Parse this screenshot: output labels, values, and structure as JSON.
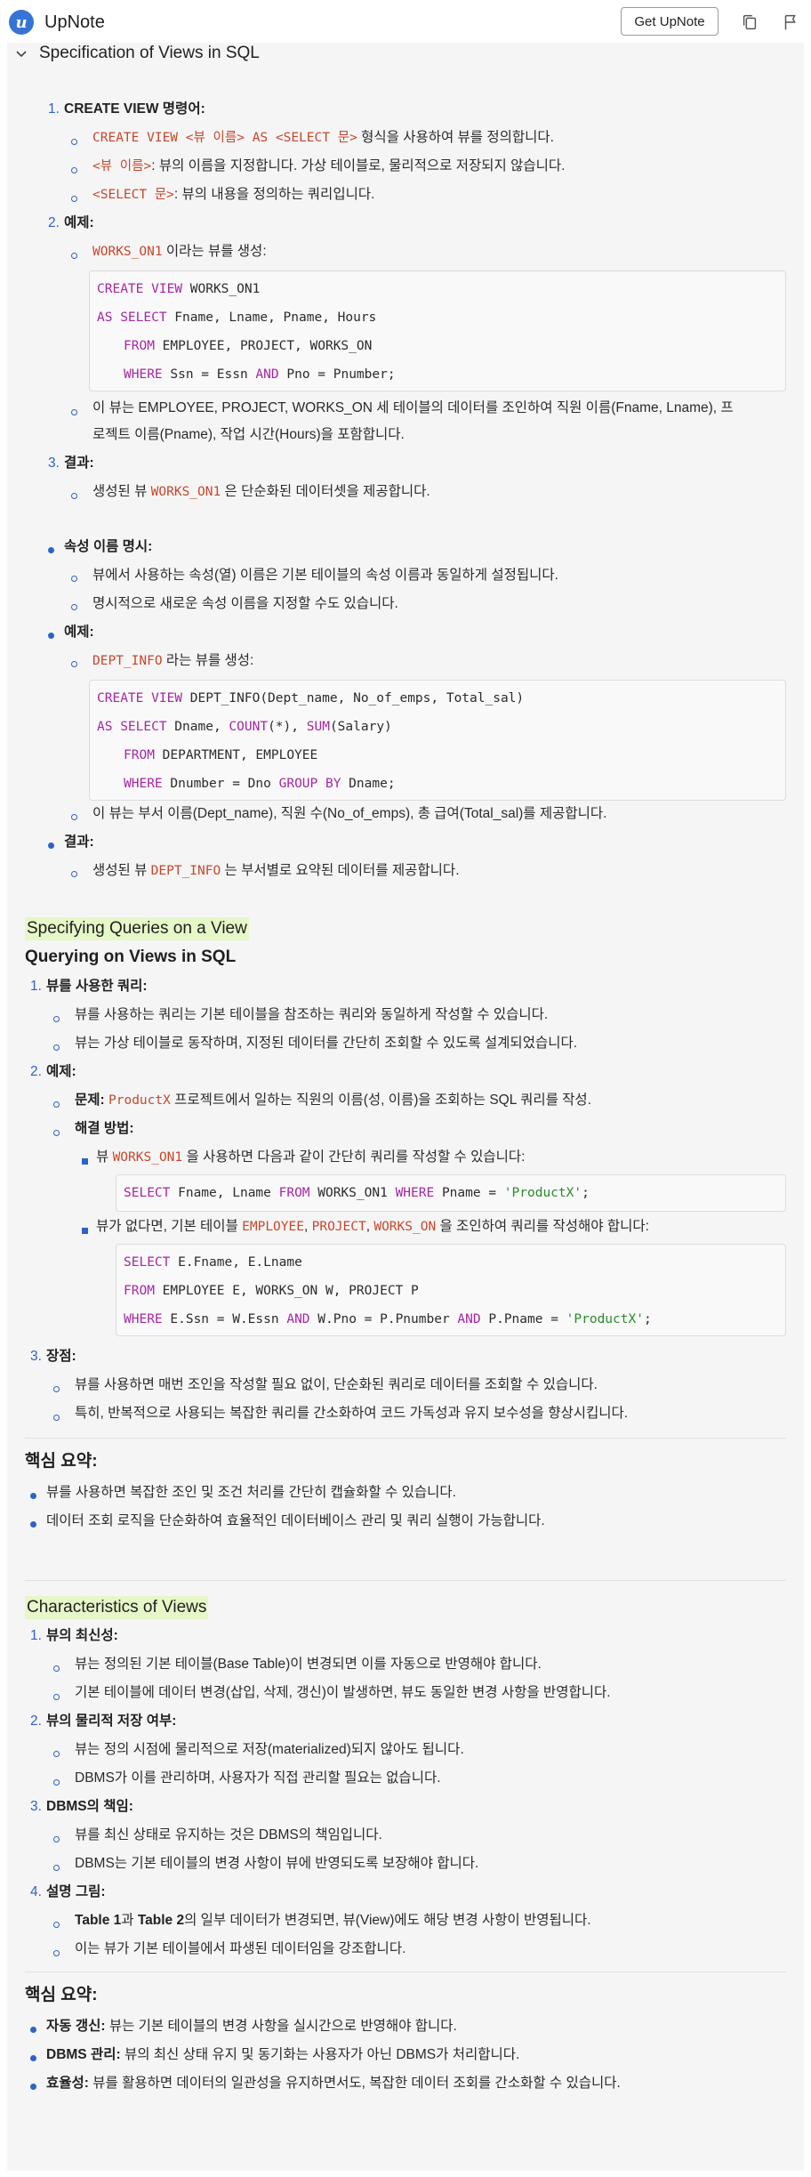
{
  "header": {
    "app_name": "UpNote",
    "logo_letter": "u",
    "get_button": "Get UpNote"
  },
  "section": {
    "title": "Specification of Views in SQL"
  },
  "s1": {
    "i1_num": "1.",
    "i1_label": "CREATE VIEW 명령어:",
    "i1_b1_code": "CREATE VIEW <뷰 이름> AS <SELECT 문>",
    "i1_b1_text": " 형식을 사용하여 뷰를 정의합니다.",
    "i1_b2_code": "<뷰 이름>",
    "i1_b2_text": ": 뷰의 이름을 지정합니다. 가상 테이블로, 물리적으로 저장되지 않습니다.",
    "i1_b3_code": "<SELECT 문>",
    "i1_b3_text": ": 뷰의 내용을 정의하는 쿼리입니다.",
    "i2_num": "2.",
    "i2_label": "예제:",
    "i2_b1_code": "WORKS_ON1",
    "i2_b1_text": " 이라는 뷰를 생성:",
    "code1": [
      "CREATE VIEW WORKS_ON1",
      "AS SELECT Fname, Lname, Pname, Hours",
      "FROM EMPLOYEE, PROJECT, WORKS_ON",
      "WHERE Ssn = Essn AND Pno = Pnumber;"
    ],
    "i2_b2_text1": "이 뷰는 EMPLOYEE, PROJECT, WORKS_ON 세 테이블의 데이터를 조인하여 직원 이름(Fname, Lname), 프",
    "i2_b2_text2": "로젝트 이름(Pname), 작업 시간(Hours)을 포함합니다.",
    "i3_num": "3.",
    "i3_label": "결과:",
    "i3_b1_pre": "생성된 뷰 ",
    "i3_b1_code": "WORKS_ON1",
    "i3_b1_text": " 은 단순화된 데이터셋을 제공합니다."
  },
  "s2": {
    "i1_label": "속성 이름 명시:",
    "i1_b1": "뷰에서 사용하는 속성(열) 이름은 기본 테이블의 속성 이름과 동일하게 설정됩니다.",
    "i1_b2": "명시적으로 새로운 속성 이름을 지정할 수도 있습니다.",
    "i2_label": "예제:",
    "i2_b1_code": "DEPT_INFO",
    "i2_b1_text": " 라는 뷰를 생성:",
    "code2": [
      "CREATE VIEW DEPT_INFO(Dept_name, No_of_emps, Total_sal)",
      "AS SELECT Dname, COUNT(*), SUM(Salary)",
      "FROM DEPARTMENT, EMPLOYEE",
      "WHERE Dnumber = Dno GROUP BY Dname;"
    ],
    "i2_b2": "이 뷰는 부서 이름(Dept_name), 직원 수(No_of_emps), 총 급여(Total_sal)를 제공합니다.",
    "i3_label": "결과:",
    "i3_b1_pre": "생성된 뷰 ",
    "i3_b1_code": "DEPT_INFO",
    "i3_b1_text": " 는 부서별로 요약된 데이터를 제공합니다."
  },
  "s3": {
    "title": "Specifying Queries on a View",
    "subtitle": "Querying on Views in SQL",
    "i1_num": "1.",
    "i1_label": "뷰를 사용한 쿼리:",
    "i1_b1": "뷰를 사용하는 쿼리는 기본 테이블을 참조하는 쿼리와 동일하게 작성할 수 있습니다.",
    "i1_b2": "뷰는 가상 테이블로 동작하며, 지정된 데이터를 간단히 조회할 수 있도록 설계되었습니다.",
    "i2_num": "2.",
    "i2_label": "예제:",
    "i2_b1_label": "문제:",
    "i2_b1_code": "ProductX",
    "i2_b1_text": " 프로젝트에서 일하는 직원의 이름(성, 이름)을 조회하는 SQL 쿼리를 작성.",
    "i2_b2_label": "해결 방법:",
    "i2_s1_pre": "뷰 ",
    "i2_s1_code": "WORKS_ON1",
    "i2_s1_text": " 을 사용하면 다음과 같이 간단히 쿼리를 작성할 수 있습니다:",
    "code3": "SELECT Fname, Lname FROM WORKS_ON1 WHERE Pname = 'ProductX';",
    "i2_s2_pre": "뷰가 없다면, 기본 테이블 ",
    "i2_s2_code1": "EMPLOYEE",
    "i2_s2_sep1": ", ",
    "i2_s2_code2": "PROJECT",
    "i2_s2_sep2": ", ",
    "i2_s2_code3": "WORKS_ON",
    "i2_s2_text": " 을 조인하여 쿼리를 작성해야 합니다:",
    "code4": [
      "SELECT E.Fname, E.Lname",
      "FROM EMPLOYEE E, WORKS_ON W, PROJECT P",
      "WHERE E.Ssn = W.Essn AND W.Pno = P.Pnumber AND P.Pname = 'ProductX';"
    ],
    "i3_num": "3.",
    "i3_label": "장점:",
    "i3_b1": "뷰를 사용하면 매번 조인을 작성할 필요 없이, 단순화된 쿼리로 데이터를 조회할 수 있습니다.",
    "i3_b2": "특히, 반복적으로 사용되는 복잡한 쿼리를 간소화하여 코드 가독성과 유지 보수성을 향상시킵니다.",
    "summary_title": "핵심 요약:",
    "sum_b1": "뷰를 사용하면 복잡한 조인 및 조건 처리를 간단히 캡슐화할 수 있습니다.",
    "sum_b2": "데이터 조회 로직을 단순화하여 효율적인 데이터베이스 관리 및 쿼리 실행이 가능합니다."
  },
  "s4": {
    "title": "Characteristics of Views",
    "i1_num": "1.",
    "i1_label": "뷰의 최신성:",
    "i1_b1": "뷰는 정의된 기본 테이블(Base Table)이 변경되면 이를 자동으로 반영해야 합니다.",
    "i1_b2": "기본 테이블에 데이터 변경(삽입, 삭제, 갱신)이 발생하면, 뷰도 동일한 변경 사항을 반영합니다.",
    "i2_num": "2.",
    "i2_label": "뷰의 물리적 저장 여부:",
    "i2_b1": "뷰는 정의 시점에 물리적으로 저장(materialized)되지 않아도 됩니다.",
    "i2_b2": "DBMS가 이를 관리하며, 사용자가 직접 관리할 필요는 없습니다.",
    "i3_num": "3.",
    "i3_label": "DBMS의 책임:",
    "i3_b1": "뷰를 최신 상태로 유지하는 것은 DBMS의 책임입니다.",
    "i3_b2": "DBMS는 기본 테이블의 변경 사항이 뷰에 반영되도록 보장해야 합니다.",
    "i4_num": "4.",
    "i4_label": "설명 그림:",
    "i4_b1_t1": "Table 1",
    "i4_b1_mid": "과 ",
    "i4_b1_t2": "Table 2",
    "i4_b1_text": "의 일부 데이터가 변경되면, 뷰(View)에도 해당 변경 사항이 반영됩니다.",
    "i4_b2": "이는 뷰가 기본 테이블에서 파생된 데이터임을 강조합니다.",
    "summary_title": "핵심 요약:",
    "sum_b1_label": "자동 갱신:",
    "sum_b1_text": " 뷰는 기본 테이블의 변경 사항을 실시간으로 반영해야 합니다.",
    "sum_b2_label": "DBMS 관리:",
    "sum_b2_text": " 뷰의 최신 상태 유지 및 동기화는 사용자가 아닌 DBMS가 처리합니다.",
    "sum_b3_label": "효율성:",
    "sum_b3_text": " 뷰를 활용하면 데이터의 일관성을 유지하면서도, 복잡한 데이터 조회를 간소화할 수 있습니다."
  }
}
